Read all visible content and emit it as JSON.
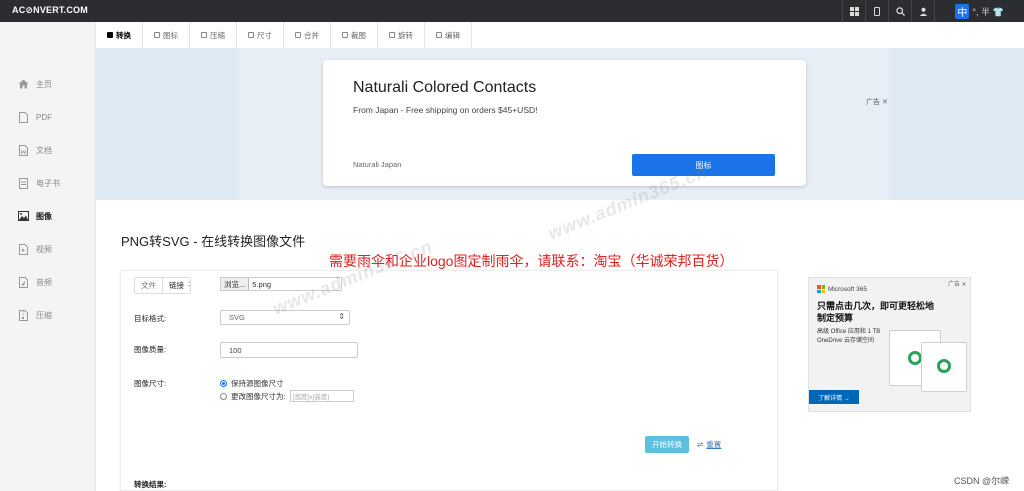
{
  "header": {
    "logo": "AC⊘NVERT.COM",
    "icons": [
      "grid-icon",
      "mobile-icon",
      "search-icon",
      "user-icon"
    ],
    "lang_active": "中",
    "lang_others": "°, 半 👕"
  },
  "sidebar": {
    "items": [
      {
        "label": "主页",
        "icon": "home-icon",
        "active": false
      },
      {
        "label": "PDF",
        "icon": "pdf-icon",
        "active": false
      },
      {
        "label": "文档",
        "icon": "word-icon",
        "active": false
      },
      {
        "label": "电子书",
        "icon": "ebook-icon",
        "active": false
      },
      {
        "label": "图像",
        "icon": "image-icon",
        "active": true
      },
      {
        "label": "视频",
        "icon": "video-icon",
        "active": false
      },
      {
        "label": "音频",
        "icon": "audio-icon",
        "active": false
      },
      {
        "label": "压缩",
        "icon": "archive-icon",
        "active": false
      }
    ]
  },
  "tabs": [
    {
      "label": "转换",
      "active": true
    },
    {
      "label": "图标",
      "active": false
    },
    {
      "label": "压缩",
      "active": false
    },
    {
      "label": "尺寸",
      "active": false
    },
    {
      "label": "合并",
      "active": false
    },
    {
      "label": "裁图",
      "active": false
    },
    {
      "label": "旋转",
      "active": false
    },
    {
      "label": "编辑",
      "active": false
    }
  ],
  "top_ad": {
    "title": "Naturali Colored Contacts",
    "subtitle": "From Japan - Free shipping on orders $45+USD!",
    "brand": "Naturali Japan",
    "button": "图标",
    "badge": "广告 ✕"
  },
  "main": {
    "title": "PNG转SVG - 在线转换图像文件",
    "notice": "需要雨伞和企业logo图定制雨伞，请联系：淘宝（华诚荣邦百货）",
    "source_toggle": {
      "file": "文件",
      "link": "链接"
    },
    "colon": ":",
    "browse_button": "浏览...",
    "file_name": "5.png",
    "target_format_label": "目标格式:",
    "target_format_value": "SVG",
    "quality_label": "图像质量:",
    "quality_value": "100",
    "size_label": "图像尺寸:",
    "size_keep": "保持源图像尺寸",
    "size_change": "更改图像尺寸为:",
    "size_placeholder": "[宽度]x[高度]",
    "start_button": "开始转换",
    "reset_link": "重置",
    "result_label": "转换结果:"
  },
  "side_ad": {
    "brand": "Microsoft 365",
    "title": "只需点击几次，即可更轻松地制定预算",
    "subtitle": "高级 Office 应用和 1 TB OneDrive 云存储空间",
    "button": "了解详情 →",
    "close": "广告 ✕"
  },
  "watermark": "www.admin365.cn",
  "footer": {
    "csdn": "CSDN @尔嵘"
  },
  "colors": {
    "accent": "#1a73e8",
    "topbar": "#2b2d30",
    "notice": "#e02020",
    "start": "#5bc0de"
  }
}
